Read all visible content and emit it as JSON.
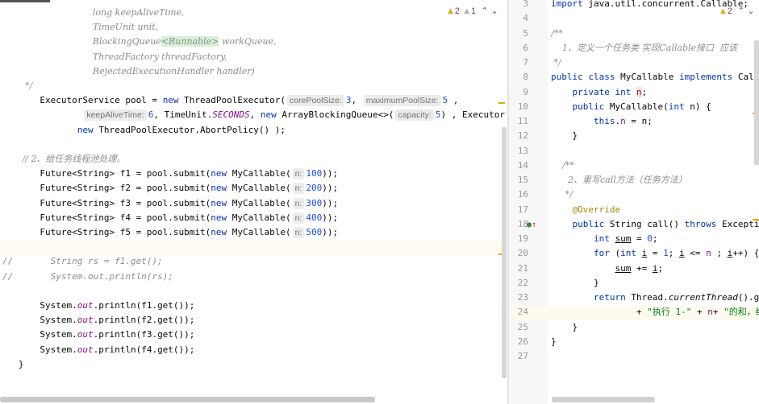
{
  "left_editor": {
    "warnings": {
      "error_count": "2",
      "warning_count": "1",
      "up": "⌃",
      "down": "⌄"
    },
    "lines": [
      [
        [
          "c",
          "                                long keepAliveTime,"
        ]
      ],
      [
        [
          "c",
          "                                TimeUnit unit,"
        ]
      ],
      [
        [
          "c",
          "                                BlockingQueue"
        ],
        [
          "cg",
          "<Runnable>"
        ],
        [
          "c",
          " workQueue,"
        ]
      ],
      [
        [
          "c",
          "                                ThreadFactory threadFactory,"
        ]
      ],
      [
        [
          "c",
          "                                RejectedExecutionHandler handler)"
        ]
      ],
      [
        [
          "c",
          "        */"
        ]
      ],
      [
        [
          "t",
          "       ExecutorService pool = "
        ],
        [
          "k",
          "new"
        ],
        [
          "t",
          " ThreadPoolExecutor("
        ],
        [
          "h",
          "corePoolSize:"
        ],
        [
          "n",
          "3"
        ],
        [
          "t",
          ", "
        ],
        [
          "h",
          "maximumPoolSize:"
        ],
        [
          "n",
          "5"
        ],
        [
          "t",
          " ,"
        ]
      ],
      [
        [
          "t",
          "               "
        ],
        [
          "h",
          "keepAliveTime:"
        ],
        [
          "n",
          "6"
        ],
        [
          "t",
          ", TimeUnit."
        ],
        [
          "fi",
          "SECONDS"
        ],
        [
          "t",
          ", "
        ],
        [
          "k",
          "new"
        ],
        [
          "t",
          " ArrayBlockingQueue<>("
        ],
        [
          "h",
          "capacity:"
        ],
        [
          "n",
          "5"
        ],
        [
          "t",
          ") , Executor"
        ]
      ],
      [
        [
          "t",
          "              "
        ],
        [
          "k",
          "new"
        ],
        [
          "t",
          " ThreadPoolExecutor.AbortPolicy() );"
        ]
      ],
      [],
      [
        [
          "c",
          "       // 2、给任务线程池处理。"
        ]
      ],
      [
        [
          "t",
          "       Future<String> f1 = pool.submit("
        ],
        [
          "k",
          "new"
        ],
        [
          "t",
          " MyCallable("
        ],
        [
          "h",
          "n:"
        ],
        [
          "n",
          "100"
        ],
        [
          "t",
          "));"
        ]
      ],
      [
        [
          "t",
          "       Future<String> f2 = pool.submit("
        ],
        [
          "k",
          "new"
        ],
        [
          "t",
          " MyCallable("
        ],
        [
          "h",
          "n:"
        ],
        [
          "n",
          "200"
        ],
        [
          "t",
          "));"
        ]
      ],
      [
        [
          "t",
          "       Future<String> f3 = pool.submit("
        ],
        [
          "k",
          "new"
        ],
        [
          "t",
          " MyCallable("
        ],
        [
          "h",
          "n:"
        ],
        [
          "n",
          "300"
        ],
        [
          "t",
          "));"
        ]
      ],
      [
        [
          "t",
          "       Future<String> f4 = pool.submit("
        ],
        [
          "k",
          "new"
        ],
        [
          "t",
          " MyCallable("
        ],
        [
          "h",
          "n:"
        ],
        [
          "n",
          "400"
        ],
        [
          "t",
          "));"
        ]
      ],
      [
        [
          "t",
          "       Future<String> f5 = pool.submit("
        ],
        [
          "k",
          "new"
        ],
        [
          "t",
          " MyCallable("
        ],
        [
          "h",
          "n:"
        ],
        [
          "n",
          "500"
        ],
        [
          "t",
          "));"
        ]
      ],
      [],
      [
        [
          "cm",
          "//       String rs = f1.get();"
        ]
      ],
      [
        [
          "cm",
          "//       System.out.println(rs);"
        ]
      ],
      [],
      [
        [
          "t",
          "       System."
        ],
        [
          "fi",
          "out"
        ],
        [
          "t",
          ".println(f1.get());"
        ]
      ],
      [
        [
          "t",
          "       System."
        ],
        [
          "fi",
          "out"
        ],
        [
          "t",
          ".println(f2.get());"
        ]
      ],
      [
        [
          "t",
          "       System."
        ],
        [
          "fi",
          "out"
        ],
        [
          "t",
          ".println(f3.get());"
        ]
      ],
      [
        [
          "t",
          "       System."
        ],
        [
          "fi",
          "out"
        ],
        [
          "t",
          ".println(f4.get());"
        ]
      ],
      [
        [
          "t",
          "   }"
        ]
      ]
    ]
  },
  "right_editor": {
    "warnings": {
      "error_count": "2",
      "up": "⌃",
      "down": "⌄"
    },
    "line_numbers": [
      "3",
      "4",
      "5",
      "6",
      "7",
      "8",
      "9",
      "10",
      "11",
      "12",
      "13",
      "14",
      "15",
      "16",
      "17",
      "18",
      "19",
      "20",
      "21",
      "22",
      "23",
      "24",
      "25",
      "26",
      "27"
    ],
    "lines": [
      [
        [
          "k",
          "import"
        ],
        [
          "t",
          " java.util.concurrent.Callable;"
        ]
      ],
      [],
      [
        [
          "c",
          "/**"
        ]
      ],
      [
        [
          "c",
          "    1、定义一个任务类 实现Callable接口  应该"
        ]
      ],
      [
        [
          "c",
          " */"
        ]
      ],
      [
        [
          "k",
          "public class"
        ],
        [
          "t",
          " MyCallable "
        ],
        [
          "k",
          "implements"
        ],
        [
          "t",
          " Callable<String> {"
        ]
      ],
      [
        [
          "t",
          "    "
        ],
        [
          "k",
          "private int"
        ],
        [
          "t",
          " "
        ],
        [
          "fhl",
          "n"
        ],
        [
          "t",
          ";"
        ]
      ],
      [
        [
          "t",
          "    "
        ],
        [
          "k",
          "public"
        ],
        [
          "t",
          " MyCallable("
        ],
        [
          "k",
          "int"
        ],
        [
          "t",
          " n) {"
        ]
      ],
      [
        [
          "t",
          "        "
        ],
        [
          "k",
          "this"
        ],
        [
          "t",
          "."
        ],
        [
          "f",
          "n"
        ],
        [
          "t",
          " = n;"
        ]
      ],
      [
        [
          "t",
          "    }"
        ]
      ],
      [],
      [
        [
          "c",
          "    /**"
        ]
      ],
      [
        [
          "c",
          "      2、重写call方法（任务方法）"
        ]
      ],
      [
        [
          "c",
          "     */"
        ]
      ],
      [
        [
          "t",
          "    "
        ],
        [
          "a",
          "@Override"
        ]
      ],
      [
        [
          "t",
          "    "
        ],
        [
          "k",
          "public"
        ],
        [
          "t",
          " String call() "
        ],
        [
          "k",
          "throws"
        ],
        [
          "t",
          " Exception {"
        ]
      ],
      [
        [
          "t",
          "        "
        ],
        [
          "k",
          "int"
        ],
        [
          "t",
          " "
        ],
        [
          "u",
          "sum"
        ],
        [
          "t",
          " = "
        ],
        [
          "n",
          "0"
        ],
        [
          "t",
          ";"
        ]
      ],
      [
        [
          "t",
          "        "
        ],
        [
          "k",
          "for"
        ],
        [
          "t",
          " ("
        ],
        [
          "k",
          "int"
        ],
        [
          "t",
          " "
        ],
        [
          "u",
          "i"
        ],
        [
          "t",
          " = "
        ],
        [
          "n",
          "1"
        ],
        [
          "t",
          "; "
        ],
        [
          "u",
          "i"
        ],
        [
          "t",
          " <= "
        ],
        [
          "f",
          "n"
        ],
        [
          "t",
          " ; "
        ],
        [
          "u",
          "i"
        ],
        [
          "t",
          "++) {"
        ]
      ],
      [
        [
          "t",
          "            "
        ],
        [
          "u",
          "sum"
        ],
        [
          "t",
          " += "
        ],
        [
          "u",
          "i"
        ],
        [
          "t",
          ";"
        ]
      ],
      [
        [
          "t",
          "        }"
        ]
      ],
      [
        [
          "t",
          "        "
        ],
        [
          "k",
          "return"
        ],
        [
          "t",
          " Thread."
        ],
        [
          "i",
          "currentThread"
        ],
        [
          "t",
          "().getName()"
        ]
      ],
      [
        [
          "t",
          "                + "
        ],
        [
          "s",
          "\"执行 1-\""
        ],
        [
          "t",
          " + "
        ],
        [
          "f",
          "n"
        ],
        [
          "t",
          "+ "
        ],
        [
          "s",
          "\"的和，结"
        ]
      ],
      [
        [
          "t",
          "    }"
        ]
      ],
      [
        [
          "t",
          "}"
        ]
      ],
      []
    ]
  }
}
